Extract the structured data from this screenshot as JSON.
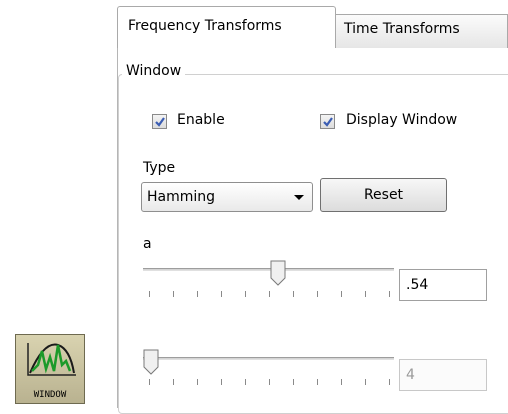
{
  "tabs": [
    {
      "label": "Frequency Transforms",
      "active": true
    },
    {
      "label": "Time Transforms",
      "active": false
    }
  ],
  "window_group": {
    "legend": "Window",
    "enable": {
      "label": "Enable",
      "checked": true
    },
    "display_window": {
      "label": "Display Window",
      "checked": true
    },
    "type": {
      "label": "Type",
      "selected": "Hamming"
    },
    "reset_label": "Reset",
    "slider_a": {
      "label": "a",
      "value": ".54"
    },
    "slider_b": {
      "value": "4",
      "enabled": false
    }
  },
  "window_icon": {
    "caption": "WINDOW",
    "icon": "window-function-plot-icon"
  },
  "colors": {
    "checkmark": "#3b5db3",
    "icon_bg": "#c9c3a0",
    "icon_green": "#1c9a2a"
  }
}
